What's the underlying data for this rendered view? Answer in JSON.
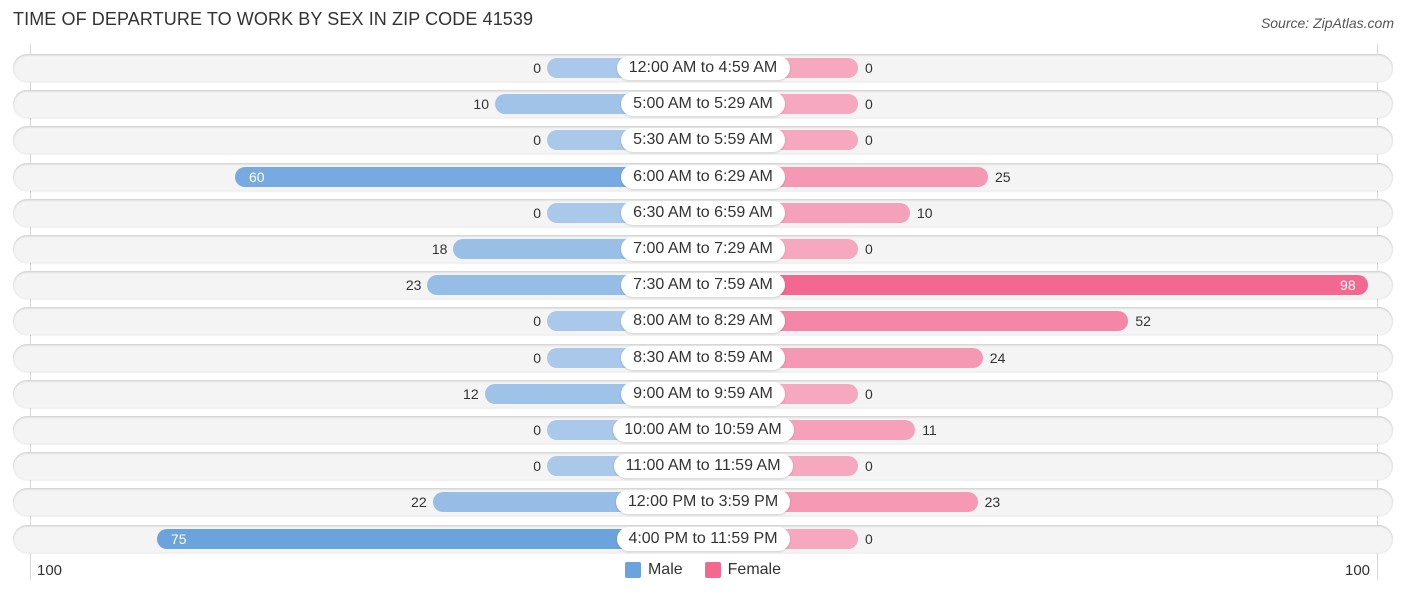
{
  "header": {
    "title": "TIME OF DEPARTURE TO WORK BY SEX IN ZIP CODE 41539",
    "source": "Source: ZipAtlas.com"
  },
  "colors": {
    "male_light": "#a9c8ea",
    "male_strong": "#6ba3dd",
    "female_light": "#f6a8c0",
    "female_strong": "#f26890",
    "row_bg": "#f4f4f4"
  },
  "chart_data": {
    "type": "bar",
    "orientation": "horizontal-diverging",
    "title": "TIME OF DEPARTURE TO WORK BY SEX IN ZIP CODE 41539",
    "xlabel": "",
    "ylabel": "",
    "xlim": [
      -100,
      100
    ],
    "axis_tick_labels": {
      "left": "100",
      "right": "100"
    },
    "legend_position": "bottom-center",
    "grid": false,
    "categories": [
      "12:00 AM to 4:59 AM",
      "5:00 AM to 5:29 AM",
      "5:30 AM to 5:59 AM",
      "6:00 AM to 6:29 AM",
      "6:30 AM to 6:59 AM",
      "7:00 AM to 7:29 AM",
      "7:30 AM to 7:59 AM",
      "8:00 AM to 8:29 AM",
      "8:30 AM to 8:59 AM",
      "9:00 AM to 9:59 AM",
      "10:00 AM to 10:59 AM",
      "11:00 AM to 11:59 AM",
      "12:00 PM to 3:59 PM",
      "4:00 PM to 11:59 PM"
    ],
    "series": [
      {
        "name": "Male",
        "side": "left",
        "values": [
          0,
          10,
          0,
          60,
          0,
          18,
          23,
          0,
          0,
          12,
          0,
          0,
          22,
          75
        ]
      },
      {
        "name": "Female",
        "side": "right",
        "values": [
          0,
          0,
          0,
          25,
          10,
          0,
          98,
          52,
          24,
          0,
          11,
          0,
          23,
          0
        ]
      }
    ]
  },
  "legend": {
    "items": [
      {
        "label": "Male",
        "color": "#6ba3dd"
      },
      {
        "label": "Female",
        "color": "#f26890"
      }
    ]
  }
}
